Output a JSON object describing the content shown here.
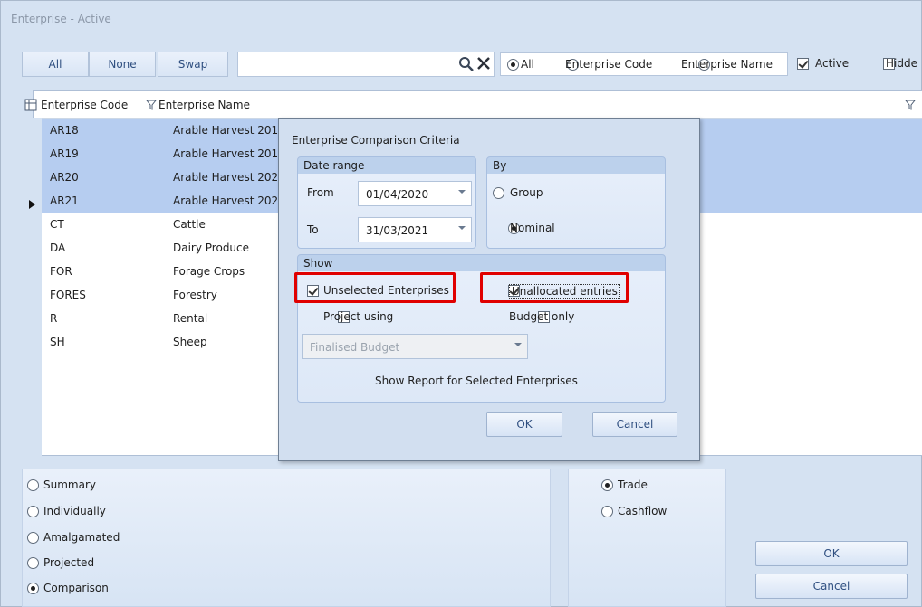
{
  "window": {
    "title": "Enterprise - Active"
  },
  "toolbar": {
    "all_label": "All",
    "none_label": "None",
    "swap_label": "Swap",
    "search_value": "",
    "filter_options": [
      "All",
      "Enterprise Code",
      "Enterprise Name"
    ],
    "filter_selected": "All",
    "active_label": "Active",
    "active_checked": true,
    "hidden_label": "Hidde",
    "hidden_checked": false
  },
  "grid": {
    "columns": [
      "Enterprise Code",
      "Enterprise Name"
    ],
    "rows": [
      {
        "code": "AR18",
        "name": "Arable Harvest 201",
        "selected": true
      },
      {
        "code": "AR19",
        "name": "Arable Harvest 201",
        "selected": true
      },
      {
        "code": "AR20",
        "name": "Arable Harvest 202",
        "selected": true
      },
      {
        "code": "AR21",
        "name": "Arable Harvest 202",
        "selected": true,
        "current": true
      },
      {
        "code": "CT",
        "name": "Cattle",
        "selected": false
      },
      {
        "code": "DA",
        "name": "Dairy Produce",
        "selected": false
      },
      {
        "code": "FOR",
        "name": "Forage Crops",
        "selected": false
      },
      {
        "code": "FORES",
        "name": "Forestry",
        "selected": false
      },
      {
        "code": "R",
        "name": "Rental",
        "selected": false
      },
      {
        "code": "SH",
        "name": "Sheep",
        "selected": false
      }
    ]
  },
  "dialog": {
    "title": "Enterprise Comparison Criteria",
    "date_range": {
      "title": "Date range",
      "from_label": "From",
      "from_value": "01/04/2020",
      "to_label": "To",
      "to_value": "31/03/2021"
    },
    "by": {
      "title": "By",
      "group_label": "Group",
      "nominal_label": "Nominal",
      "selected": "Nominal"
    },
    "show": {
      "title": "Show",
      "unselected_label": "Unselected Enterprises",
      "unselected_checked": true,
      "unallocated_label": "Unallocated entries",
      "unallocated_checked": true,
      "project_label": "Project using",
      "project_checked": false,
      "budget_label": "Budget only",
      "budget_checked": false,
      "budget_combo_value": "Finalised Budget",
      "report_text": "Show Report for Selected Enterprises"
    },
    "ok_label": "OK",
    "cancel_label": "Cancel"
  },
  "report_type": {
    "options": [
      "Summary",
      "Individually",
      "Amalgamated",
      "Projected",
      "Comparison"
    ],
    "selected": "Comparison"
  },
  "basis": {
    "options": [
      "Trade",
      "Cashflow"
    ],
    "selected": "Trade"
  },
  "footer": {
    "ok_label": "OK",
    "cancel_label": "Cancel"
  },
  "colors": {
    "selection": "#b6cdf0",
    "highlight": "#e00000",
    "frame": "#d5e2f2"
  }
}
